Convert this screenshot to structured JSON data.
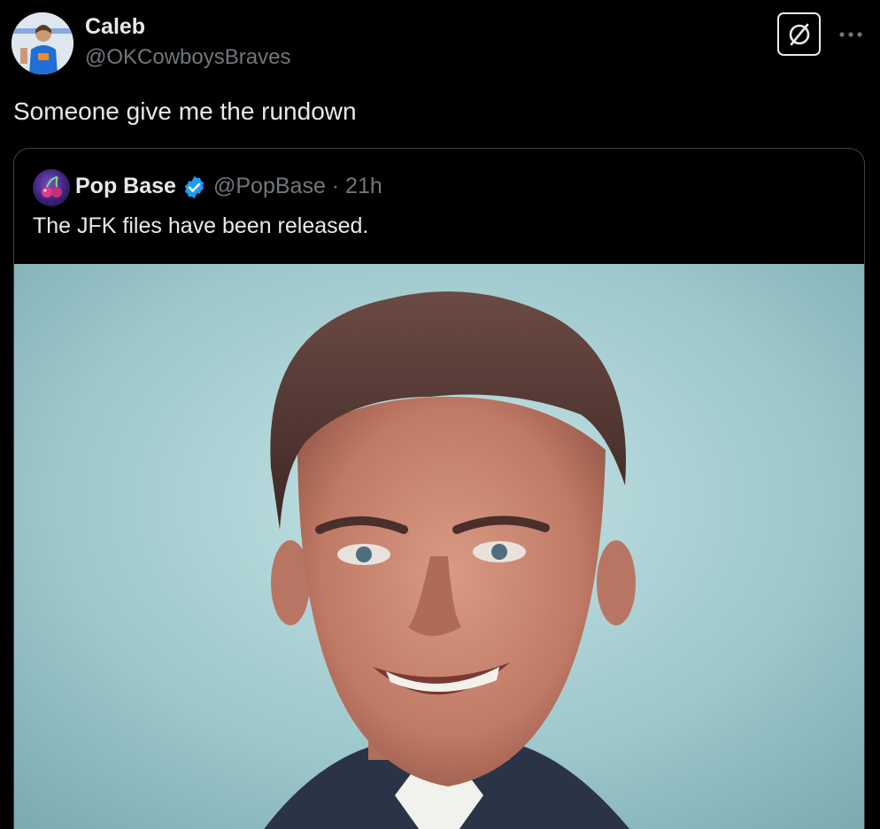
{
  "author": {
    "display_name": "Caleb",
    "handle": "@OKCowboysBraves",
    "avatar_icon": "profile-avatar"
  },
  "header": {
    "grok_icon": "grok-icon",
    "more_icon": "more-icon"
  },
  "tweet": {
    "text": "Someone give me the rundown"
  },
  "quoted_tweet": {
    "display_name": "Pop Base",
    "verified_icon": "verified-badge-icon",
    "meta": "@PopBase · 21h",
    "text": "The JFK files have been released.",
    "image": "portrait-photo"
  },
  "colors": {
    "background": "#000000",
    "primary_text": "#e7e9ea",
    "secondary_text": "#71767b",
    "border": "#3e4144",
    "verified_blue": "#1d9bf0"
  }
}
